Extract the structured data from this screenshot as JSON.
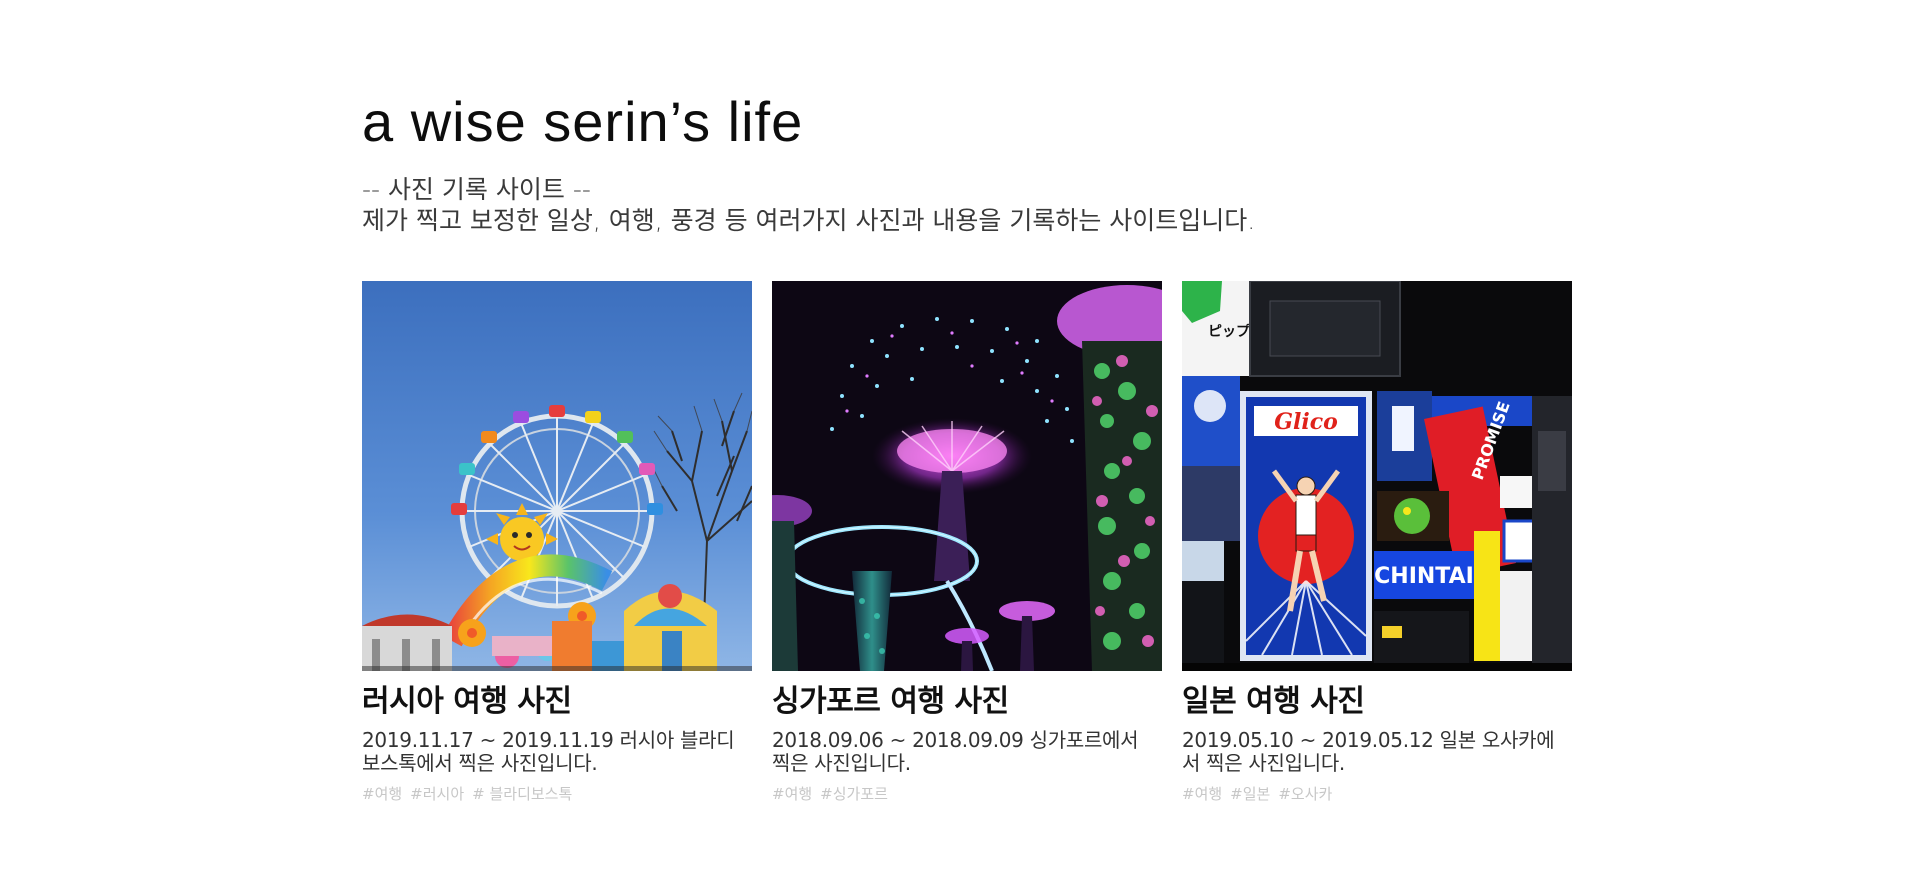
{
  "header": {
    "title": "a wise serin’s life",
    "subtitle_line1": "-- 사진 기록 사이트 --",
    "subtitle_line2": "제가 찍고 보정한 일상, 여행, 풍경 등 여러가지 사진과 내용을 기록하는 사이트입니다."
  },
  "cards": [
    {
      "title": "러시아 여행 사진",
      "description": "2019.11.17 ~ 2019.11.19 러시아 블라디보스톡에서 찍은 사진입니다.",
      "tags": [
        "#여행",
        "#러시아",
        "# 블라디보스톡"
      ],
      "photo_icon": "ferris-wheel-photo"
    },
    {
      "title": "싱가포르 여행 사진",
      "description": "2018.09.06 ~ 2018.09.09 싱가포르에서 찍은 사진입니다.",
      "tags": [
        "#여행",
        "#싱가포르"
      ],
      "photo_icon": "supertree-grove-photo"
    },
    {
      "title": "일본 여행 사진",
      "description": "2019.05.10 ~ 2019.05.12 일본 오사카에서 찍은 사진입니다.",
      "tags": [
        "#여행",
        "#일본",
        "#오사카"
      ],
      "photo_icon": "dotonbori-signs-photo",
      "sign_text": {
        "glico": "Glico",
        "chintai": "CHINTAI",
        "pip": "ピップ",
        "promise": "PROMISE"
      }
    }
  ],
  "colors": {
    "tag": "#c7c7c7",
    "text": "#111111",
    "sky": "#3f74c2"
  }
}
